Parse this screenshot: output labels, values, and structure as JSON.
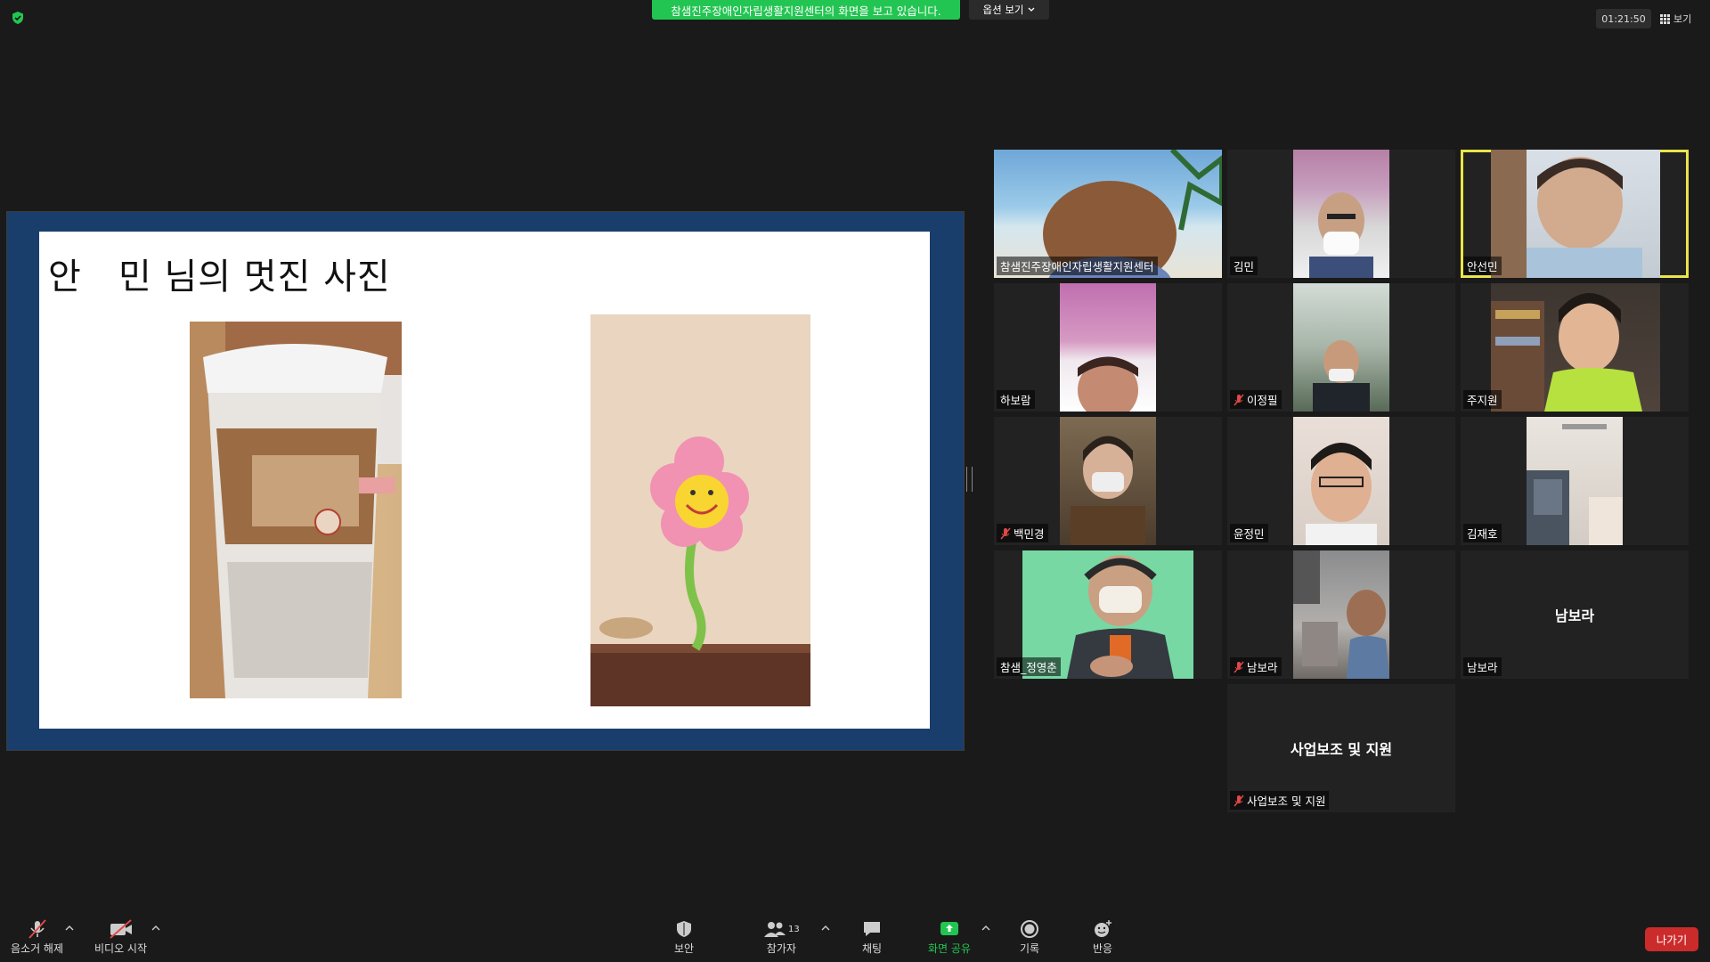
{
  "top": {
    "share_banner": "참샘진주장애인자립생활지원센터의 화면을 보고 있습니다.",
    "view_options": "옵션 보기",
    "timer": "01:21:50",
    "view_toggle": "보기"
  },
  "slide": {
    "title": "안   민 님의 멋진 사진"
  },
  "participants": [
    {
      "name": "참샘진주장애인자립생활지원센터",
      "muted": false,
      "active": false
    },
    {
      "name": "김민",
      "muted": false,
      "active": false
    },
    {
      "name": "안선민",
      "muted": false,
      "active": true
    },
    {
      "name": "하보람",
      "muted": false,
      "active": false
    },
    {
      "name": "이정필",
      "muted": true,
      "active": false
    },
    {
      "name": "주지원",
      "muted": false,
      "active": false
    },
    {
      "name": "백민경",
      "muted": true,
      "active": false
    },
    {
      "name": "윤정민",
      "muted": false,
      "active": false
    },
    {
      "name": "김재호",
      "muted": false,
      "active": false
    },
    {
      "name": "참샘_정영춘",
      "muted": false,
      "active": false
    },
    {
      "name": "남보라",
      "muted": true,
      "active": false
    },
    {
      "name": "남보라",
      "muted": false,
      "active": false,
      "center_label": "남보라"
    },
    {
      "name": "사업보조 및 지원",
      "muted": true,
      "active": false,
      "center_label": "사업보조 및 지원"
    }
  ],
  "toolbar": {
    "unmute": "음소거 해제",
    "start_video": "비디오 시작",
    "security": "보안",
    "participants": "참가자",
    "participants_count": "13",
    "chat": "채팅",
    "share_screen": "화면 공유",
    "record": "기록",
    "reactions": "반응",
    "leave": "나가기"
  },
  "colors": {
    "share_banner": "#23c552",
    "active_speaker": "#e9e54b",
    "leave": "#cc2b2b",
    "share_frame": "#1a3e6c"
  }
}
